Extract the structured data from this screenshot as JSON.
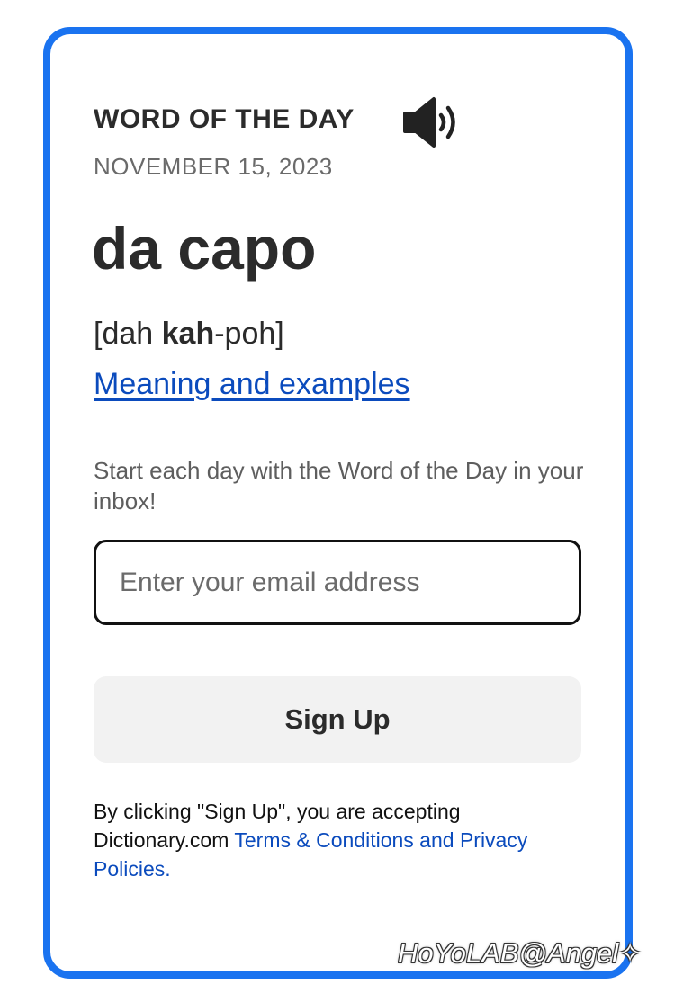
{
  "card": {
    "section_label": "WORD OF THE DAY",
    "audio_icon": "speaker-volume-icon",
    "date": "NOVEMBER 15, 2023",
    "word": "da capo",
    "pronunciation": {
      "open": "[dah ",
      "stressed": "kah",
      "rest": "-poh]"
    },
    "meaning_link": "Meaning and examples"
  },
  "signup": {
    "promo_text": "Start each day with the Word of the Day in your inbox!",
    "email_placeholder": "Enter your email address",
    "email_value": "",
    "button_label": "Sign Up",
    "legal_prefix": "By clicking \"Sign Up\", you are accepting Dictionary.com ",
    "legal_link": "Terms & Conditions and Privacy Policies."
  },
  "watermark": "HoYoLAB@Angel✧",
  "colors": {
    "frame_border": "#1a73f0",
    "link": "#0b4bbd",
    "button_bg": "#f2f2f2",
    "text": "#2b2b2b"
  }
}
